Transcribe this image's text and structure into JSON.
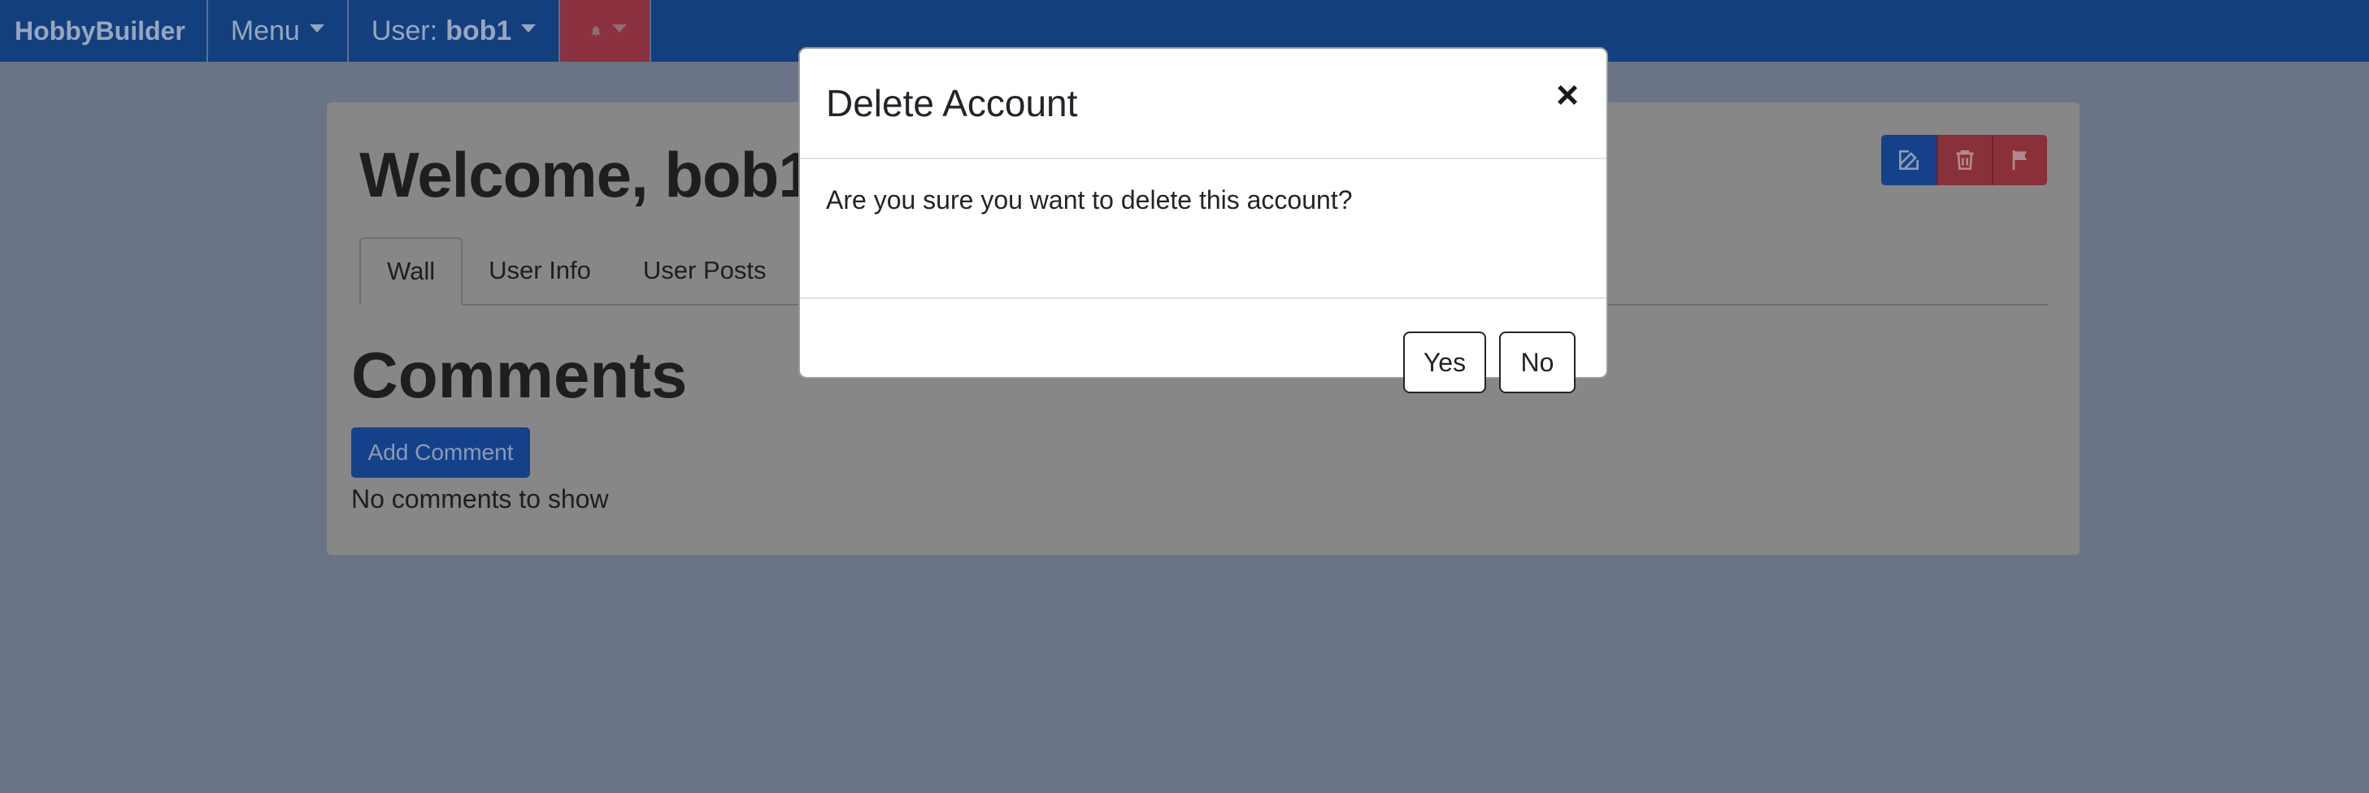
{
  "navbar": {
    "brand": "HobbyBuilder",
    "menu_label": "Menu",
    "user_prefix": "User:",
    "username": "bob1"
  },
  "profile": {
    "title": "Welcome, bob1",
    "tabs": [
      {
        "label": "Wall",
        "active": true
      },
      {
        "label": "User Info",
        "active": false
      },
      {
        "label": "User Posts",
        "active": false
      }
    ],
    "comments_heading": "Comments",
    "add_comment_label": "Add Comment",
    "empty_text": "No comments to show"
  },
  "modal": {
    "title": "Delete Account",
    "close_glyph": "×",
    "body": "Are you sure you want to delete this account?",
    "yes_label": "Yes",
    "no_label": "No"
  },
  "colors": {
    "navbar_bg": "#133f7f",
    "primary": "#14418a",
    "danger": "#8a3038",
    "backdrop": "#6b7486"
  }
}
